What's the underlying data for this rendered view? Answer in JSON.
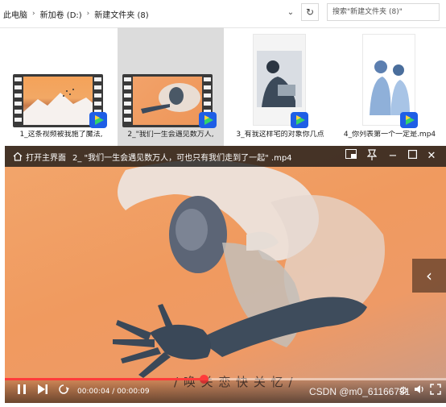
{
  "explorer": {
    "breadcrumbs": [
      "此电脑",
      "新加卷 (D:)",
      "新建文件夹 (8)"
    ],
    "search_placeholder": "搜索\"新建文件夹 (8)\"",
    "files": [
      {
        "name": "1_这条视频被我施了魔法,",
        "selected": false
      },
      {
        "name": "2_\"我们一生会遇见数万人,",
        "selected": true
      },
      {
        "name": "3_有我这样宅的对象你几点",
        "selected": false
      },
      {
        "name": "4_你列表第一个一定是.mp4",
        "selected": false
      }
    ]
  },
  "player": {
    "home_label": "打开主界面",
    "title": "2_ \"我们一生会遇见数万人，可也只有我们走到了一起\" .mp4",
    "subtitle": "/ 唤 关 恋 快 关 忆 /",
    "current_time": "00:00:04",
    "total_time": "00:00:09",
    "time_separator": " / ",
    "progress": 0.45,
    "watermark": "CSDN @m0_61166731"
  },
  "colors": {
    "progress_red": "#ff3b3b",
    "video_orange": "#f09a5f",
    "selected_tile": "#dcdcdc"
  },
  "icons": {
    "home": "home-icon",
    "dropdown": "chevron-down-icon",
    "refresh": "refresh-icon",
    "play_badge": "video-player-badge-icon",
    "pause": "pause-icon",
    "next": "next-icon",
    "loop": "loop-icon",
    "fullscreen": "fullscreen-icon",
    "volume": "volume-icon",
    "settings": "settings-icon",
    "close": "close-icon",
    "maximize": "maximize-icon",
    "minimize": "minimize-icon",
    "pin": "pin-icon",
    "pip": "picture-in-picture-icon",
    "side_arrow": "chevron-left-icon"
  }
}
